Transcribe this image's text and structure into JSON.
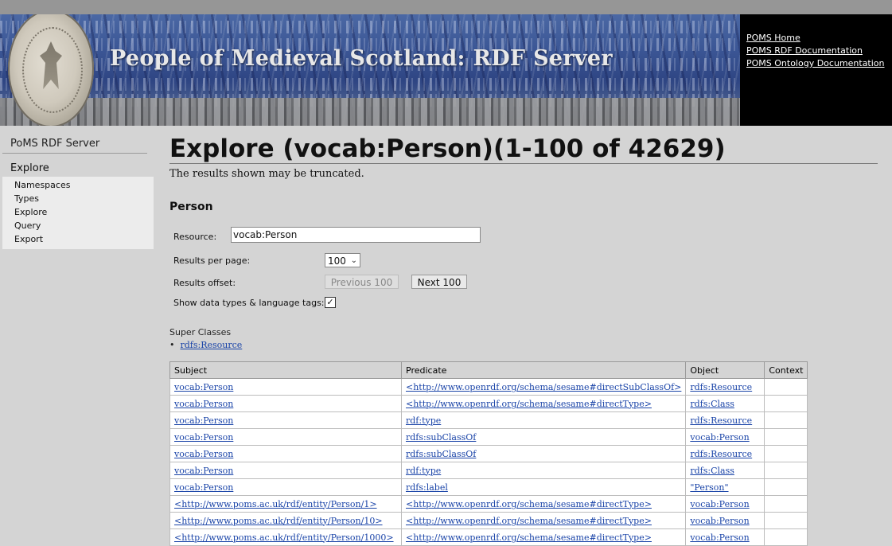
{
  "header": {
    "site_title": "People of Medieval Scotland: RDF Server",
    "links": [
      "POMS Home",
      "POMS RDF Documentation",
      "POMS Ontology Documentation"
    ]
  },
  "sidebar": {
    "title": "PoMS RDF Server",
    "section": "Explore",
    "items": [
      "Namespaces",
      "Types",
      "Explore",
      "Query",
      "Export"
    ]
  },
  "main": {
    "heading": "Explore (vocab:Person)(1-100 of 42629)",
    "note": "The results shown may be truncated.",
    "subheading": "Person",
    "form": {
      "resource_label": "Resource:",
      "resource_value": "vocab:Person",
      "results_per_page_label": "Results per page:",
      "results_per_page_value": "100",
      "results_offset_label": "Results offset:",
      "prev_button": "Previous 100",
      "next_button": "Next 100",
      "show_types_label": "Show data types & language tags:",
      "show_types_checked": true
    },
    "super_classes": {
      "label": "Super Classes",
      "items": [
        "rdfs:Resource"
      ]
    },
    "table": {
      "headers": [
        "Subject",
        "Predicate",
        "Object",
        "Context"
      ],
      "rows": [
        [
          "vocab:Person",
          "<http://www.openrdf.org/schema/sesame#directSubClassOf>",
          "rdfs:Resource",
          ""
        ],
        [
          "vocab:Person",
          "<http://www.openrdf.org/schema/sesame#directType>",
          "rdfs:Class",
          ""
        ],
        [
          "vocab:Person",
          "rdf:type",
          "rdfs:Resource",
          ""
        ],
        [
          "vocab:Person",
          "rdfs:subClassOf",
          "vocab:Person",
          ""
        ],
        [
          "vocab:Person",
          "rdfs:subClassOf",
          "rdfs:Resource",
          ""
        ],
        [
          "vocab:Person",
          "rdf:type",
          "rdfs:Class",
          ""
        ],
        [
          "vocab:Person",
          "rdfs:label",
          "\"Person\"",
          ""
        ],
        [
          "<http://www.poms.ac.uk/rdf/entity/Person/1>",
          "<http://www.openrdf.org/schema/sesame#directType>",
          "vocab:Person",
          ""
        ],
        [
          "<http://www.poms.ac.uk/rdf/entity/Person/10>",
          "<http://www.openrdf.org/schema/sesame#directType>",
          "vocab:Person",
          ""
        ],
        [
          "<http://www.poms.ac.uk/rdf/entity/Person/1000>",
          "<http://www.openrdf.org/schema/sesame#directType>",
          "vocab:Person",
          ""
        ]
      ]
    }
  },
  "colors": {
    "page_bg": "#d4d4d4",
    "banner_blue": "#3c5796",
    "link": "#1a44a8"
  }
}
